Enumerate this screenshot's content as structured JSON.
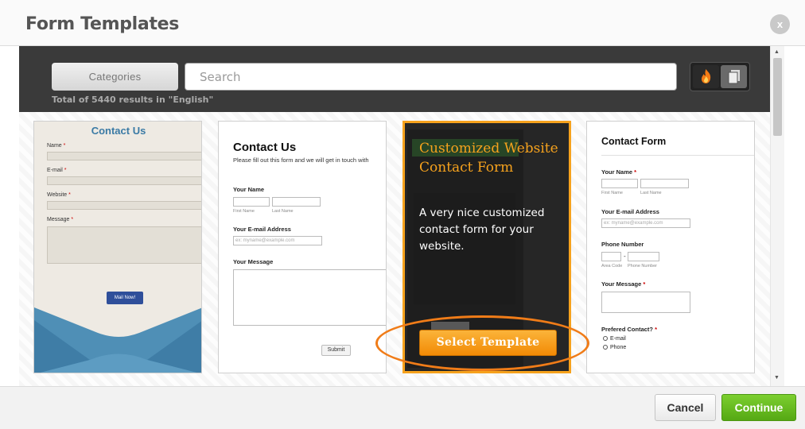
{
  "dialog": {
    "title": "Form Templates",
    "close_label": "x"
  },
  "toolbar": {
    "categories_label": "Categories",
    "search_placeholder": "Search",
    "results_text": "Total of 5440 results in \"English\"",
    "view_icons": [
      "flame-icon",
      "pages-icon"
    ]
  },
  "cards": [
    {
      "title": "Contact Us",
      "fields": [
        "Name",
        "E-mail",
        "Website",
        "Message"
      ],
      "button_label": "Mail Now!"
    },
    {
      "title": "Contact Us",
      "subtitle": "Please fill out this form and we will get in touch with",
      "name_label": "Your Name",
      "first_name": "First Name",
      "last_name": "Last Name",
      "email_label": "Your E-mail Address",
      "email_placeholder": "ex: myname@example.com",
      "message_label": "Your Message",
      "submit_label": "Submit"
    },
    {
      "title": "Customized Website Contact Form",
      "description": "A very nice customized contact form for your website.",
      "select_label": "Select Template"
    },
    {
      "title": "Contact Form",
      "name_label": "Your Name",
      "first_name": "First Name",
      "last_name": "Last Name",
      "email_label": "Your E-mail Address",
      "email_placeholder": "ex: myname@example.com",
      "phone_label": "Phone Number",
      "area_code": "Area Code",
      "phone_number": "Phone Number",
      "message_label": "Your Message",
      "preferred_label": "Prefered Contact?",
      "radio_options": [
        "E-mail",
        "Phone"
      ]
    }
  ],
  "footer": {
    "cancel_label": "Cancel",
    "continue_label": "Continue"
  },
  "colors": {
    "accent_orange": "#f6a21d",
    "continue_green": "#5cb21a",
    "toolbar_dark": "#3a3a3a"
  }
}
